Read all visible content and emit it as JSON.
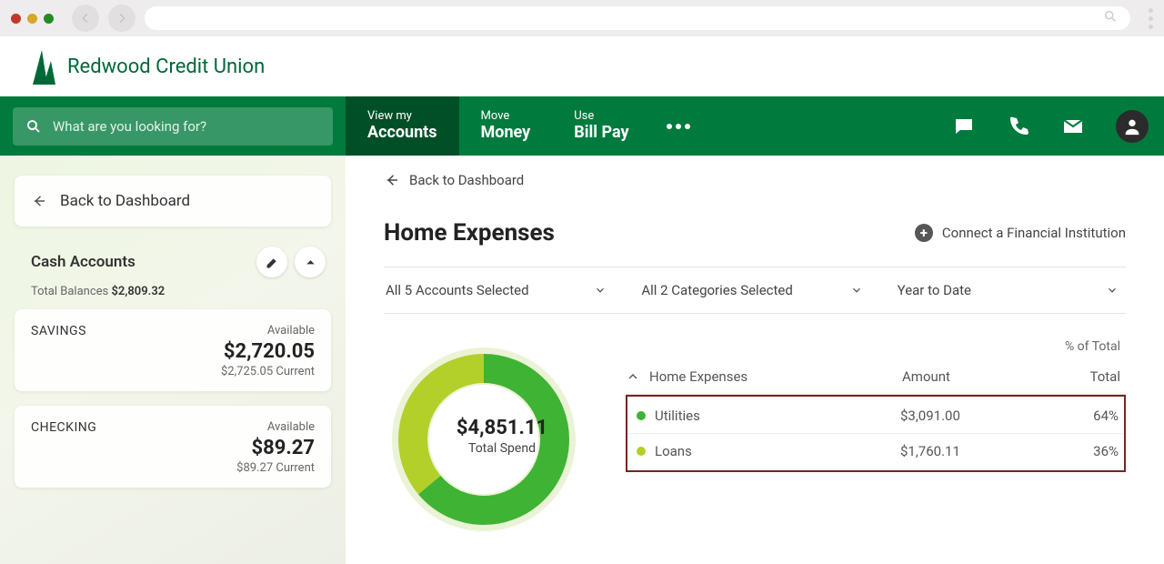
{
  "brand": {
    "name": "Redwood Credit Union"
  },
  "search": {
    "placeholder": "What are you looking for?"
  },
  "nav": {
    "accounts_small": "View my",
    "accounts_large": "Accounts",
    "move_small": "Move",
    "move_large": "Money",
    "bill_small": "Use",
    "bill_large": "Bill Pay"
  },
  "sidebar": {
    "back_label": "Back to Dashboard",
    "section_title": "Cash Accounts",
    "total_prefix": "Total Balances ",
    "total_amount": "$2,809.32",
    "accounts": [
      {
        "name": "SAVINGS",
        "available_label": "Available",
        "amount": "$2,720.05",
        "current": "$2,725.05 Current"
      },
      {
        "name": "CHECKING",
        "available_label": "Available",
        "amount": "$89.27",
        "current": "$89.27 Current"
      }
    ]
  },
  "main": {
    "back_label": "Back to Dashboard",
    "title": "Home Expenses",
    "connect_label": "Connect a Financial Institution",
    "filters": {
      "accounts": "All 5 Accounts Selected",
      "categories": "All 2 Categories Selected",
      "date": "Year to Date"
    },
    "donut": {
      "amount": "$4,851.11",
      "label": "Total Spend"
    },
    "table": {
      "pct_header": "% of Total",
      "group_label": "Home Expenses",
      "amount_header": "Amount",
      "rows": [
        {
          "color": "#3fb333",
          "label": "Utilities",
          "amount": "$3,091.00",
          "pct": "64%"
        },
        {
          "color": "#b3cf2a",
          "label": "Loans",
          "amount": "$1,760.11",
          "pct": "36%"
        }
      ]
    }
  },
  "chart_data": {
    "type": "pie",
    "title": "Home Expenses — Total Spend",
    "total_label": "$4,851.11",
    "series": [
      {
        "name": "Utilities",
        "value": 3091.0,
        "pct": 64,
        "color": "#3fb333"
      },
      {
        "name": "Loans",
        "value": 1760.11,
        "pct": 36,
        "color": "#b3cf2a"
      }
    ]
  }
}
